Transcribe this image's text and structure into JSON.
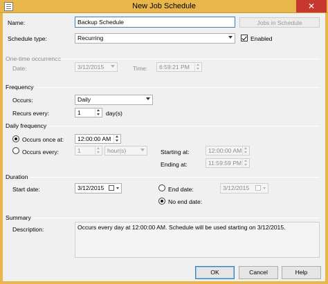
{
  "window": {
    "title": "New Job Schedule",
    "close_glyph": "✕"
  },
  "name": {
    "label": "Name:",
    "value": "Backup Schedule",
    "jobs_button": "Jobs in Schedule"
  },
  "schedule_type": {
    "label": "Schedule type:",
    "value": "Recurring",
    "enabled_label": "Enabled",
    "enabled": true
  },
  "one_time": {
    "header": "One-time occurrence",
    "date_label": "Date:",
    "date_value": "3/12/2015",
    "time_label": "Time:",
    "time_value": "6:59:21 PM"
  },
  "frequency": {
    "header": "Frequency",
    "occurs_label": "Occurs:",
    "occurs_value": "Daily",
    "recurs_label": "Recurs every:",
    "recurs_value": "1",
    "recurs_unit": "day(s)"
  },
  "daily_frequency": {
    "header": "Daily frequency",
    "once_label": "Occurs once at:",
    "once_value": "12:00:00 AM",
    "once_selected": true,
    "every_label": "Occurs every:",
    "every_value": "1",
    "every_unit": "hour(s)",
    "starting_label": "Starting at:",
    "starting_value": "12:00:00 AM",
    "ending_label": "Ending at:",
    "ending_value": "11:59:59 PM"
  },
  "duration": {
    "header": "Duration",
    "start_label": "Start date:",
    "start_value": "3/12/2015",
    "end_label": "End date:",
    "end_value": "3/12/2015",
    "no_end_label": "No end date:",
    "no_end_selected": true
  },
  "summary": {
    "header": "Summary",
    "description_label": "Description:",
    "description": "Occurs every day at 12:00:00 AM. Schedule will be used starting on 3/12/2015."
  },
  "buttons": {
    "ok": "OK",
    "cancel": "Cancel",
    "help": "Help"
  },
  "colors": {
    "title_bar": "#e8b64a",
    "close_button": "#c7372f",
    "dialog_bg": "#f0f0f0"
  }
}
